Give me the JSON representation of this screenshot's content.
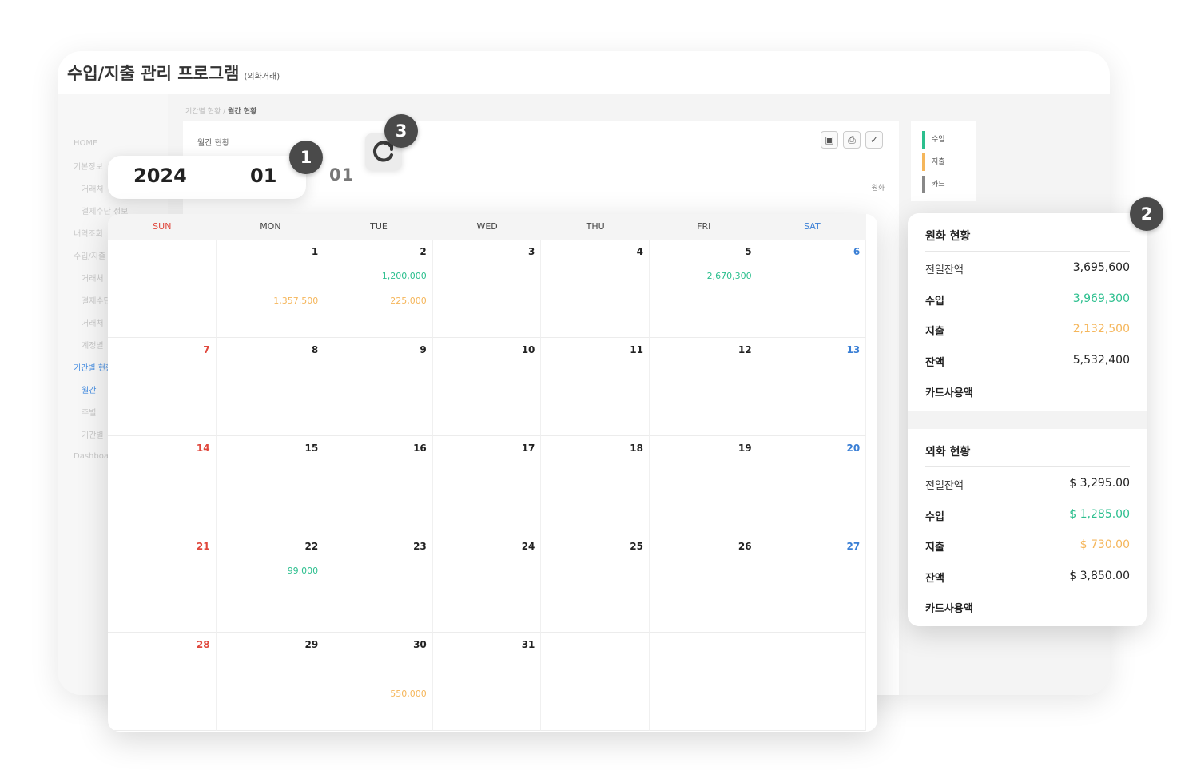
{
  "app": {
    "title": "수입/지출 관리 프로그램",
    "subtitle": "(외화거래)"
  },
  "sidebar": {
    "items": [
      {
        "label": "HOME"
      },
      {
        "label": "기본정보"
      },
      {
        "label": "거래처"
      },
      {
        "label": "결제수단 정보"
      },
      {
        "label": "내역조회"
      },
      {
        "label": "수입/지출"
      },
      {
        "label": "거래처"
      },
      {
        "label": "결제수단"
      },
      {
        "label": "거래처"
      },
      {
        "label": "계정별"
      },
      {
        "label": "기간별 현황"
      },
      {
        "label": "월간"
      },
      {
        "label": "주별"
      },
      {
        "label": "기간별"
      },
      {
        "label": "Dashboard"
      }
    ]
  },
  "breadcrumb": {
    "parent": "기간별 현황 /",
    "current": "월간 현황"
  },
  "panel": {
    "title": "월간 현황",
    "unit_label": "원화",
    "month_display": "01",
    "toolbar": [
      "laptop-icon",
      "print-icon",
      "check-icon"
    ]
  },
  "legend": [
    {
      "label": "수입",
      "color": "#2cbf8e"
    },
    {
      "label": "지출",
      "color": "#f5b65b"
    },
    {
      "label": "카드",
      "color": "#888888"
    }
  ],
  "selector": {
    "year": "2024",
    "month": "01"
  },
  "badges": {
    "one": "1",
    "two": "2",
    "three": "3"
  },
  "calendar": {
    "weekdays": [
      "SUN",
      "MON",
      "TUE",
      "WED",
      "THU",
      "FRI",
      "SAT"
    ],
    "weeks": [
      [
        {
          "day": "",
          "in": "",
          "out": ""
        },
        {
          "day": "1",
          "in": "",
          "out": "1,357,500"
        },
        {
          "day": "2",
          "in": "1,200,000",
          "out": "225,000"
        },
        {
          "day": "3",
          "in": "",
          "out": ""
        },
        {
          "day": "4",
          "in": "",
          "out": ""
        },
        {
          "day": "5",
          "in": "2,670,300",
          "out": ""
        },
        {
          "day": "6",
          "in": "",
          "out": ""
        }
      ],
      [
        {
          "day": "7",
          "in": "",
          "out": ""
        },
        {
          "day": "8",
          "in": "",
          "out": ""
        },
        {
          "day": "9",
          "in": "",
          "out": ""
        },
        {
          "day": "10",
          "in": "",
          "out": ""
        },
        {
          "day": "11",
          "in": "",
          "out": ""
        },
        {
          "day": "12",
          "in": "",
          "out": ""
        },
        {
          "day": "13",
          "in": "",
          "out": ""
        }
      ],
      [
        {
          "day": "14",
          "in": "",
          "out": ""
        },
        {
          "day": "15",
          "in": "",
          "out": ""
        },
        {
          "day": "16",
          "in": "",
          "out": ""
        },
        {
          "day": "17",
          "in": "",
          "out": ""
        },
        {
          "day": "18",
          "in": "",
          "out": ""
        },
        {
          "day": "19",
          "in": "",
          "out": ""
        },
        {
          "day": "20",
          "in": "",
          "out": ""
        }
      ],
      [
        {
          "day": "21",
          "in": "",
          "out": ""
        },
        {
          "day": "22",
          "in": "99,000",
          "out": ""
        },
        {
          "day": "23",
          "in": "",
          "out": ""
        },
        {
          "day": "24",
          "in": "",
          "out": ""
        },
        {
          "day": "25",
          "in": "",
          "out": ""
        },
        {
          "day": "26",
          "in": "",
          "out": ""
        },
        {
          "day": "27",
          "in": "",
          "out": ""
        }
      ],
      [
        {
          "day": "28",
          "in": "",
          "out": ""
        },
        {
          "day": "29",
          "in": "",
          "out": ""
        },
        {
          "day": "30",
          "in": "",
          "out": "550,000"
        },
        {
          "day": "31",
          "in": "",
          "out": ""
        },
        {
          "day": "",
          "in": "",
          "out": ""
        },
        {
          "day": "",
          "in": "",
          "out": ""
        },
        {
          "day": "",
          "in": "",
          "out": ""
        }
      ]
    ]
  },
  "summary": {
    "krw": {
      "title": "원화 현황",
      "rows": [
        {
          "label": "전일잔액",
          "value": "3,695,600",
          "type": "normal"
        },
        {
          "label": "수입",
          "value": "3,969,300",
          "type": "in"
        },
        {
          "label": "지출",
          "value": "2,132,500",
          "type": "out"
        },
        {
          "label": "잔액",
          "value": "5,532,400",
          "type": "bold"
        },
        {
          "label": "카드사용액",
          "value": "",
          "type": "normal"
        }
      ]
    },
    "fx": {
      "title": "외화 현황",
      "rows": [
        {
          "label": "전일잔액",
          "value": "$ 3,295.00",
          "type": "normal"
        },
        {
          "label": "수입",
          "value": "$ 1,285.00",
          "type": "in"
        },
        {
          "label": "지출",
          "value": "$ 730.00",
          "type": "out"
        },
        {
          "label": "잔액",
          "value": "$ 3,850.00",
          "type": "bold"
        },
        {
          "label": "카드사용액",
          "value": "",
          "type": "normal"
        }
      ]
    }
  }
}
